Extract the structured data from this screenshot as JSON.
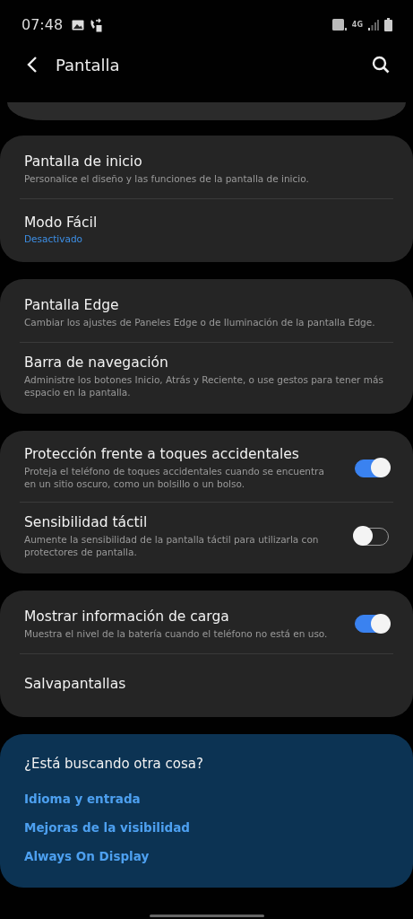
{
  "status_bar": {
    "time": "07:48",
    "network": "4G"
  },
  "header": {
    "title": "Pantalla"
  },
  "groups": [
    {
      "items": [
        {
          "title": "Pantalla de inicio",
          "summary": "Personalice el diseño y las funciones de la pantalla de inicio."
        },
        {
          "title": "Modo Fácil",
          "status": "Desactivado"
        }
      ]
    },
    {
      "items": [
        {
          "title": "Pantalla Edge",
          "summary": "Cambiar los ajustes de Paneles Edge o de Iluminación de la pantalla Edge."
        },
        {
          "title": "Barra de navegación",
          "summary": "Administre los botones Inicio, Atrás y Reciente, o use gestos para tener más espacio en la pantalla."
        }
      ]
    },
    {
      "items": [
        {
          "title": "Protección frente a toques accidentales",
          "summary": "Proteja el teléfono de toques accidentales cuando se encuentra en un sitio oscuro, como un bolsillo o un bolso.",
          "switch": {
            "on": true
          }
        },
        {
          "title": "Sensibilidad táctil",
          "summary": "Aumente la sensibilidad de la pantalla táctil para utilizarla con protectores de pantalla.",
          "switch": {
            "on": false
          }
        }
      ]
    },
    {
      "items": [
        {
          "title": "Mostrar información de carga",
          "summary": "Muestra el nivel de la batería cuando el teléfono no está en uso.",
          "switch": {
            "on": true
          }
        },
        {
          "title": "Salvapantallas"
        }
      ]
    }
  ],
  "suggestions": {
    "heading": "¿Está buscando otra cosa?",
    "links": [
      "Idioma y entrada",
      "Mejoras de la visibilidad",
      "Always On Display"
    ]
  }
}
